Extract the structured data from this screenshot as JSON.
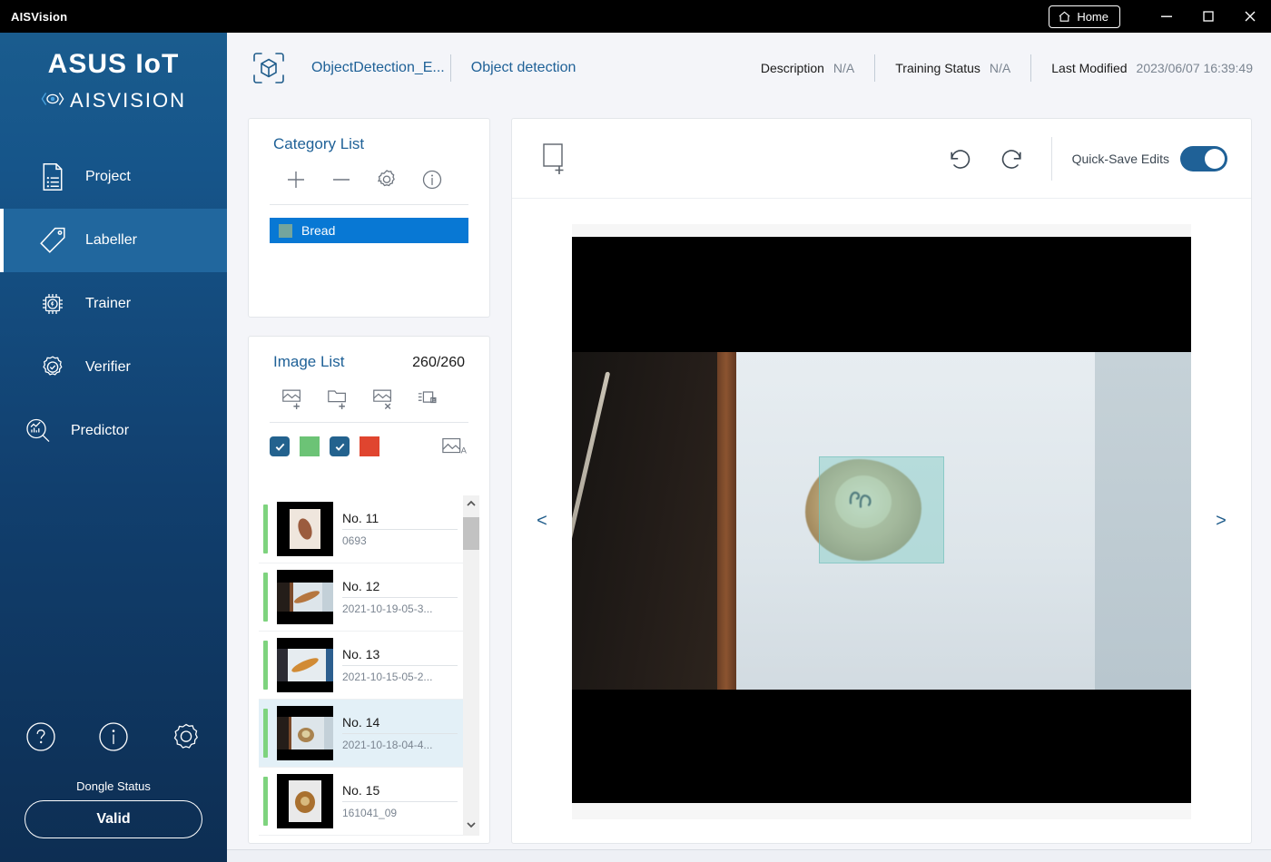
{
  "titlebar": {
    "app_title": "AISVision",
    "home_label": "Home",
    "home_icon": "house-icon",
    "minimize_icon": "minimize-icon",
    "maximize_icon": "maximize-icon",
    "close_icon": "close-icon"
  },
  "sidebar": {
    "logo_primary": "ASUS IoT",
    "logo_secondary": "AISVISION",
    "logo_mark_icon": "eye-scan-icon",
    "items": [
      {
        "label": "Project",
        "icon": "document-list-icon",
        "active": false
      },
      {
        "label": "Labeller",
        "icon": "tag-icon",
        "active": true
      },
      {
        "label": "Trainer",
        "icon": "cpu-chip-icon",
        "active": false
      },
      {
        "label": "Verifier",
        "icon": "gear-check-icon",
        "active": false
      },
      {
        "label": "Predictor",
        "icon": "magnifier-chart-icon",
        "active": false
      }
    ],
    "utilities": [
      {
        "name": "help-icon"
      },
      {
        "name": "info-icon"
      },
      {
        "name": "settings-gear-icon"
      }
    ],
    "dongle_label": "Dongle Status",
    "dongle_status": "Valid",
    "active_bg": "#21679e"
  },
  "header": {
    "project_icon": "cube-scan-icon",
    "project_name": "ObjectDetection_E...",
    "project_type": "Object detection",
    "meta": [
      {
        "key": "Description",
        "value": "N/A"
      },
      {
        "key": "Training Status",
        "value": "N/A"
      },
      {
        "key": "Last Modified",
        "value": "2023/06/07 16:39:49"
      }
    ]
  },
  "category_panel": {
    "title": "Category List",
    "tools": [
      {
        "name": "add-category-icon",
        "glyph": "+"
      },
      {
        "name": "remove-category-icon",
        "glyph": "−"
      },
      {
        "name": "category-settings-icon"
      },
      {
        "name": "category-info-icon"
      }
    ],
    "categories": [
      {
        "name": "Bread",
        "color": "#74a59d",
        "selected": true
      }
    ],
    "selected_bg": "#0878d4"
  },
  "image_panel": {
    "title": "Image List",
    "count": "260/260",
    "tools": [
      {
        "name": "add-image-icon"
      },
      {
        "name": "add-folder-icon"
      },
      {
        "name": "delete-image-icon"
      },
      {
        "name": "import-labels-icon"
      }
    ],
    "filters": [
      {
        "name": "labeled-checkbox",
        "checked": true,
        "color": "#6cc376"
      },
      {
        "name": "unlabeled-checkbox",
        "checked": true,
        "color": "#e0452f"
      }
    ],
    "name_toggle_icon": "image-name-icon",
    "scrollbar": {
      "up_icon": "chevron-up-icon",
      "down_icon": "chevron-down-icon"
    },
    "rows": [
      {
        "no": "No. 11",
        "file": "0693",
        "status_color": "#7ed37e",
        "selected": false
      },
      {
        "no": "No. 12",
        "file": "2021-10-19-05-3...",
        "status_color": "#7ed37e",
        "selected": false
      },
      {
        "no": "No. 13",
        "file": "2021-10-15-05-2...",
        "status_color": "#7ed37e",
        "selected": false
      },
      {
        "no": "No. 14",
        "file": "2021-10-18-04-4...",
        "status_color": "#7ed37e",
        "selected": true
      },
      {
        "no": "No. 15",
        "file": "161041_09",
        "status_color": "#7ed37e",
        "selected": false
      }
    ]
  },
  "canvas": {
    "draw_box_icon": "draw-bounding-box-icon",
    "undo_icon": "undo-icon",
    "redo_icon": "redo-icon",
    "quick_save_label": "Quick-Save Edits",
    "quick_save_on": true,
    "prev_label": "<",
    "next_label": ">",
    "annotation": {
      "category": "Bread",
      "color": "#80cdc6"
    }
  }
}
